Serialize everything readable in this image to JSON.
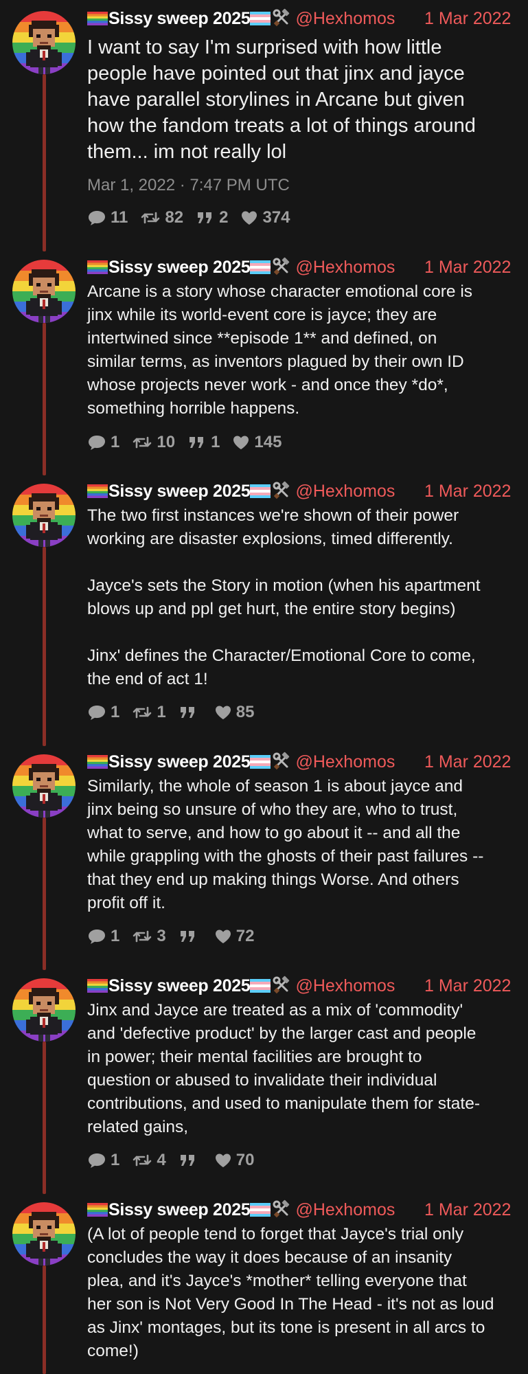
{
  "author": {
    "display_name": "Sissy sweep 2025",
    "handle": "@Hexhomos",
    "avatar_icon": "pixel-character-avatar",
    "rainbow_flag_icon": "rainbow-flag-icon",
    "trans_flag_icon": "trans-flag-icon",
    "tools_icon": "hammer-wrench-icon"
  },
  "colors": {
    "background": "#161616",
    "accent": "#ef5a5a",
    "thread_line": "#8a2e26",
    "stat_gray": "#a0a0a0"
  },
  "tweets": [
    {
      "date": "1 Mar 2022",
      "text": "I want to say I'm surprised with how little\npeople have pointed out that jinx and jayce\nhave parallel storylines in Arcane but given\nhow the fandom treats a lot of things around\nthem... im not really lol",
      "timestamp": "Mar 1, 2022 · 7:47 PM UTC",
      "replies": "11",
      "retweets": "82",
      "quotes": "2",
      "likes": "374"
    },
    {
      "date": "1 Mar 2022",
      "text": "Arcane is a story whose character emotional core is\njinx while its world-event core is jayce; they are\nintertwined since **episode 1** and defined, on\nsimilar terms, as inventors plagued by their own ID\nwhose projects never work - and once they *do*,\nsomething horrible happens.",
      "replies": "1",
      "retweets": "10",
      "quotes": "1",
      "likes": "145"
    },
    {
      "date": "1 Mar 2022",
      "text": "The two first instances we're shown of their power\nworking are disaster explosions, timed differently.\n\nJayce's sets the Story in motion (when his apartment\nblows up and ppl get hurt, the entire story begins)\n\nJinx' defines the Character/Emotional Core to come,\nthe end of act 1!",
      "replies": "1",
      "retweets": "1",
      "quotes": "",
      "likes": "85"
    },
    {
      "date": "1 Mar 2022",
      "text": "Similarly, the whole of season 1 is about jayce and\njinx being so unsure of who they are, who to trust,\nwhat to serve, and how to go about it -- and all the\nwhile grappling with the ghosts of their past failures --\nthat they end up making things Worse. And others\nprofit off it.",
      "replies": "1",
      "retweets": "3",
      "quotes": "",
      "likes": "72"
    },
    {
      "date": "1 Mar 2022",
      "text": "Jinx and Jayce are treated as a mix of 'commodity'\nand 'defective product' by the larger cast and people\nin power; their mental facilities are brought to\nquestion or abused to invalidate their individual\ncontributions, and used to manipulate them for state-\nrelated gains,",
      "replies": "1",
      "retweets": "4",
      "quotes": "",
      "likes": "70"
    },
    {
      "date": "1 Mar 2022",
      "text": "(A lot of people tend to forget that Jayce's trial only\nconcludes the way it does because of an insanity\nplea, and it's Jayce's *mother* telling everyone that\nher son is Not Very Good In The Head - it's not as loud\nas Jinx' montages, but its tone is present in all arcs to\ncome!)"
    }
  ]
}
